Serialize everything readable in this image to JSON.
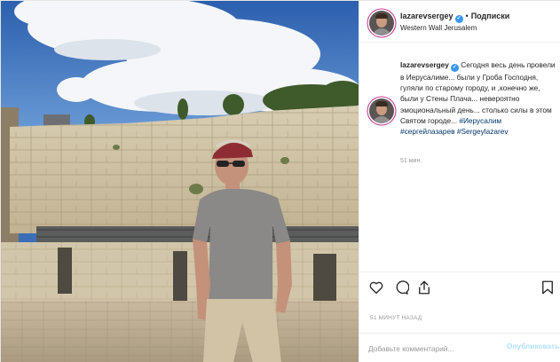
{
  "post": {
    "username": "lazarevsergey",
    "separator": "•",
    "follow_label": "Подписки",
    "location": "Western Wall Jerusalem",
    "caption": {
      "username": "lazarevsergey",
      "text": "Сегодня весь день провели в Иерусалиме... были у Гроба Господня, гуляли по старому городу, и ,конечно же, были у Стены Плача... невероятно эмоциональный день... столько силы в этом Святом городе...",
      "hashtags": [
        "#Иерусалим",
        "#сергейлазарев",
        "#Sergeylazarev"
      ],
      "time": "51 мин."
    },
    "posted_time": "51 МИНУТ НАЗАД",
    "comment_placeholder": "Добавьте комментарий...",
    "publish_label": "Опубликовать",
    "icons": {
      "verified": "verified-badge-icon",
      "like": "heart-icon",
      "comment": "comment-icon",
      "share": "share-icon",
      "save": "bookmark-icon"
    },
    "colors": {
      "verified": "#3897f0",
      "hashtag": "#003569",
      "muted": "#999999",
      "publish_disabled": "#b2dffc",
      "story_ring": "#c62b8a"
    }
  }
}
